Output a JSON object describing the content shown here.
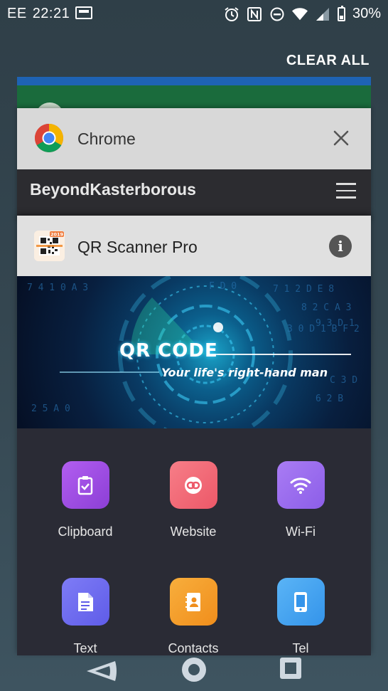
{
  "status_bar": {
    "carrier": "EE",
    "time": "22:21",
    "battery": "30%"
  },
  "recents": {
    "clear_all": "CLEAR ALL"
  },
  "chrome_card": {
    "app_title": "Chrome",
    "site_title": "BeyondKasterborous"
  },
  "qr_card": {
    "app_title": "QR Scanner Pro",
    "icon_badge": "2019",
    "banner_title": "QR CODE",
    "banner_tagline": "Your life's right-hand man",
    "tiles": [
      {
        "label": "Clipboard",
        "icon": "clipboard-icon",
        "color": "#a34ee0"
      },
      {
        "label": "Website",
        "icon": "link-icon",
        "color": "#f06a78"
      },
      {
        "label": "Wi-Fi",
        "icon": "wifi-icon",
        "color": "#9b6cf0"
      },
      {
        "label": "Text",
        "icon": "document-icon",
        "color": "#6f6cf0"
      },
      {
        "label": "Contacts",
        "icon": "contacts-icon",
        "color": "#f5a02a"
      },
      {
        "label": "Tel",
        "icon": "phone-icon",
        "color": "#3fa4f0"
      }
    ]
  },
  "colors": {
    "background": "#344650",
    "chrome_header": "#d8d8d8",
    "qr_header": "#e0e0e0",
    "card_body": "#2a2b35"
  }
}
